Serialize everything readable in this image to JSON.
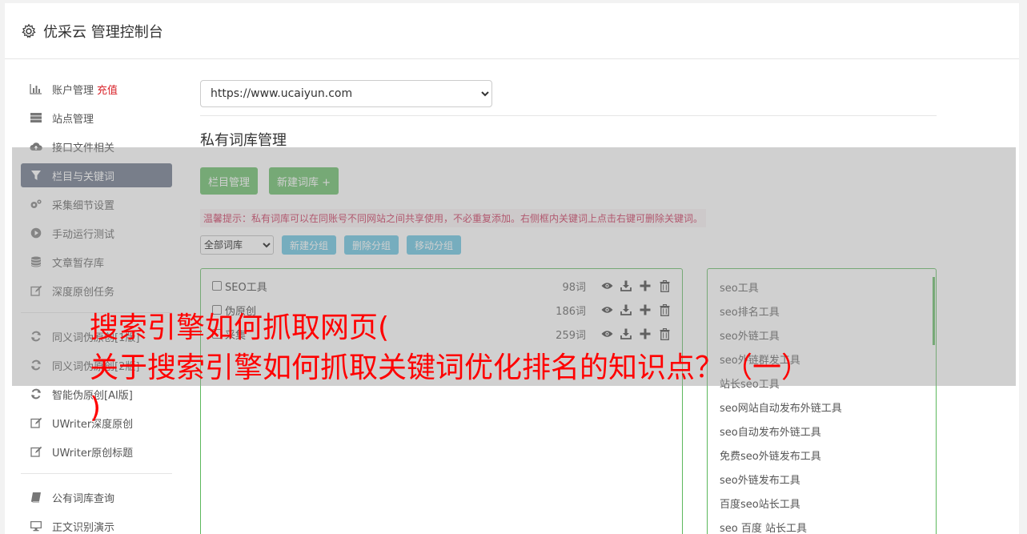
{
  "header": {
    "title": "优采云 管理控制台"
  },
  "sidebar": {
    "group1": [
      {
        "label": "账户管理",
        "badge": "充值",
        "icon": "bar-chart-icon"
      },
      {
        "label": "站点管理",
        "icon": "server-icon"
      },
      {
        "label": "接口文件相关",
        "icon": "cloud-upload-icon"
      },
      {
        "label": "栏目与关键词",
        "icon": "filter-icon",
        "active": true
      },
      {
        "label": "采集细节设置",
        "icon": "gears-icon"
      },
      {
        "label": "手动运行测试",
        "icon": "play-circle-icon"
      },
      {
        "label": "文章暂存库",
        "icon": "database-icon"
      },
      {
        "label": "深度原创任务",
        "icon": "edit-icon"
      }
    ],
    "group2": [
      {
        "label": "同义词伪原创[1版]",
        "icon": "refresh-icon"
      },
      {
        "label": "同义词伪原创[2版]",
        "icon": "refresh-icon"
      },
      {
        "label": "智能伪原创[AI版]",
        "icon": "refresh-icon"
      },
      {
        "label": "UWriter深度原创",
        "icon": "edit-icon"
      },
      {
        "label": "UWriter原创标题",
        "icon": "edit-icon"
      }
    ],
    "group3": [
      {
        "label": "公有词库查询",
        "icon": "book-icon"
      },
      {
        "label": "正文识别演示",
        "icon": "monitor-icon"
      }
    ]
  },
  "main": {
    "site_select": "https://www.ucaiyun.com",
    "section_title": "私有词库管理",
    "btn_column": "栏目管理",
    "btn_new_lib": "新建词库 +",
    "tip": "温馨提示：私有词库可以在同账号不同网站之间共享使用，不必重复添加。右侧框内关键词上点击右键可删除关键词。",
    "group_select": "全部词库",
    "btn_new_group": "新建分组",
    "btn_del_group": "删除分组",
    "btn_move_group": "移动分组",
    "libraries": [
      {
        "name": "SEO工具",
        "count": "98词"
      },
      {
        "name": "伪原创",
        "count": "186词"
      },
      {
        "name": "采集",
        "count": "259词"
      }
    ],
    "keywords": [
      "seo工具",
      "seo排名工具",
      "seo外链工具",
      "seo外链群发工具",
      "站长seo工具",
      "seo网站自动发布外链工具",
      "seo自动发布外链工具",
      "免费seo外链发布工具",
      "seo外链发布工具",
      "百度seo站长工具",
      "seo 百度 站长工具"
    ]
  },
  "overlay": {
    "line1": "搜索引擎如何抓取网页(",
    "line2": "关于搜索引擎如何抓取关键词优化排名的知识点？（一）",
    "line3": ")"
  },
  "colors": {
    "accent_green": "#5cb85c",
    "accent_blue": "#5bc0de",
    "active_nav": "#5f6b80",
    "headline": "#ff0000"
  }
}
